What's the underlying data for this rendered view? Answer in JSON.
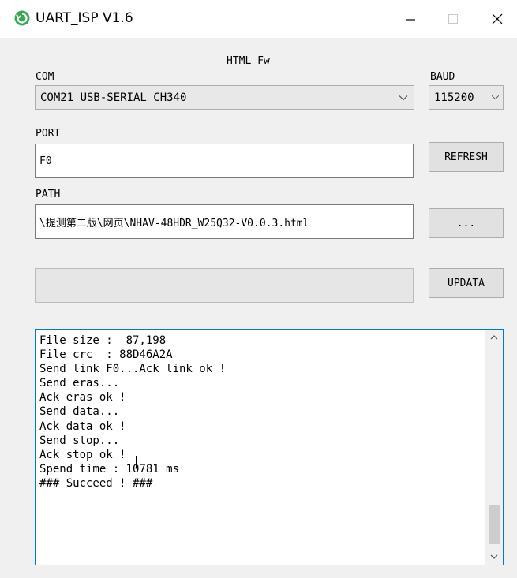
{
  "window": {
    "title": "UART_ISP V1.6",
    "icon": "refresh-circle-icon",
    "accent_color": "#34a853"
  },
  "header_label": "HTML Fw",
  "com": {
    "label": "COM",
    "selected": "COM21 USB-SERIAL CH340"
  },
  "baud": {
    "label": "BAUD",
    "selected": "115200"
  },
  "port": {
    "label": "PORT",
    "value": "F0"
  },
  "path": {
    "label": "PATH",
    "value": "\\提测第二版\\网页\\NHAV-48HDR_W25Q32-V0.0.3.html"
  },
  "buttons": {
    "refresh": "REFRESH",
    "browse": "...",
    "updata": "UPDATA"
  },
  "progress": {
    "value": 0,
    "color": "#06b025"
  },
  "log": {
    "lines": [
      "File size :  87,198",
      "File crc  : 88D46A2A",
      "Send link F0...Ack link ok !",
      "Send eras...",
      "Ack eras ok !",
      "Send data...",
      "Ack data ok !",
      "Send stop...",
      "Ack stop ok !",
      "Spend time : 10781 ms",
      "### Succeed ! ###"
    ],
    "border_color": "#0078d7"
  }
}
